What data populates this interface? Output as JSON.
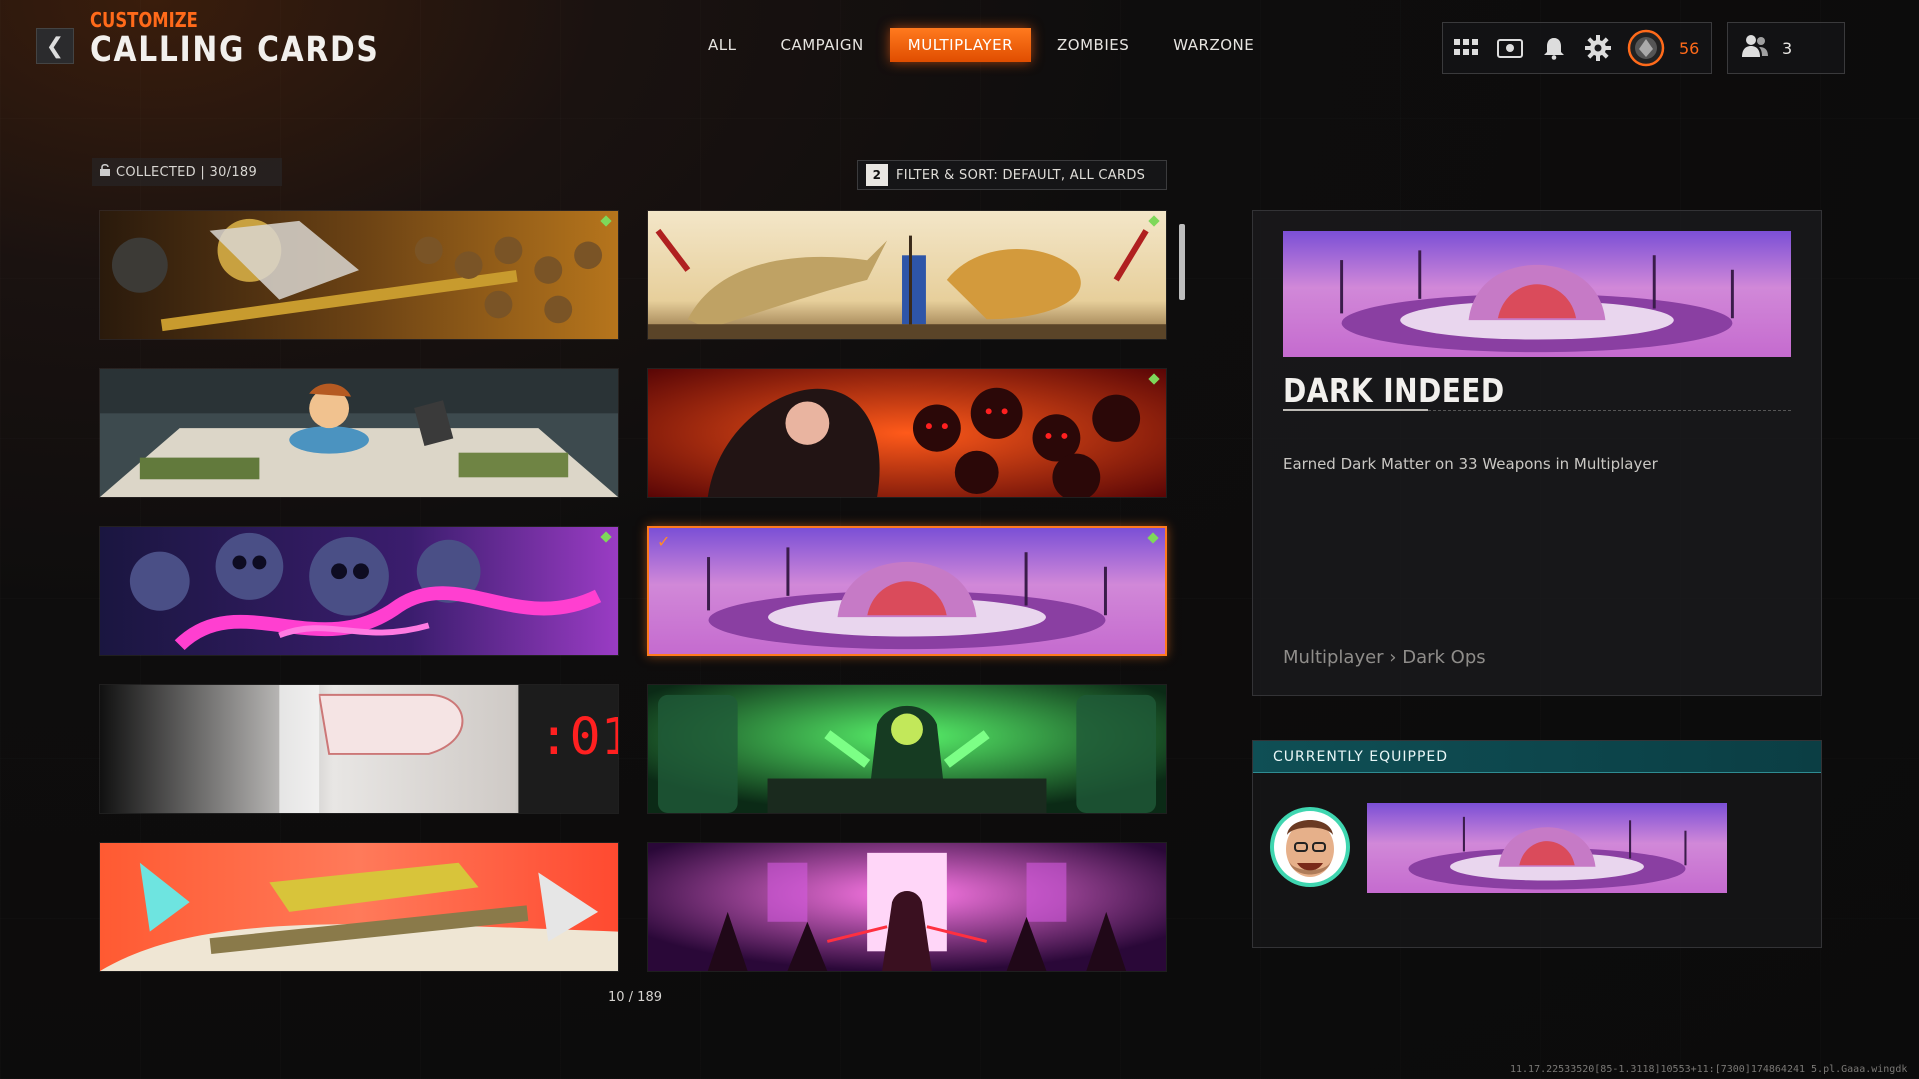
{
  "header": {
    "subtitle": "CUSTOMIZE",
    "title": "CALLING CARDS",
    "back_icon": "chevron-left-icon"
  },
  "tabs": [
    {
      "label": "ALL",
      "active": false
    },
    {
      "label": "CAMPAIGN",
      "active": false
    },
    {
      "label": "MULTIPLAYER",
      "active": true
    },
    {
      "label": "ZOMBIES",
      "active": false
    },
    {
      "label": "WARZONE",
      "active": false
    }
  ],
  "top_bar": {
    "icons": [
      "grid-menu-icon",
      "store-icon",
      "bell-icon",
      "gear-icon",
      "player-level-icon"
    ],
    "level": "56",
    "friends_icon": "friends-icon",
    "friends_count": "3"
  },
  "collection": {
    "collected_label": "COLLECTED | 30/189",
    "filter_key": "2",
    "filter_label": "FILTER & SORT: DEFAULT, ALL CARDS"
  },
  "cards": [
    {
      "id": "card-1",
      "theme": "golden-skull-sniper",
      "new": true,
      "selected": false,
      "equipped": false
    },
    {
      "id": "card-2",
      "theme": "crocodile-vs-lion",
      "new": true,
      "selected": false,
      "equipped": false
    },
    {
      "id": "card-3",
      "theme": "cereal-kid-desk",
      "new": false,
      "selected": false,
      "equipped": false
    },
    {
      "id": "card-4",
      "theme": "red-demon-skulls",
      "new": true,
      "selected": false,
      "equipped": false
    },
    {
      "id": "card-5",
      "theme": "purple-skulls-tentacles",
      "new": true,
      "selected": false,
      "equipped": false
    },
    {
      "id": "card-6",
      "theme": "dark-matter-brain",
      "new": true,
      "selected": true,
      "equipped": true
    },
    {
      "id": "card-7",
      "theme": "bomb-timer",
      "new": false,
      "selected": false,
      "equipped": false
    },
    {
      "id": "card-8",
      "theme": "green-necromancer-lab",
      "new": false,
      "selected": false,
      "equipped": false
    },
    {
      "id": "card-9",
      "theme": "mech-dragons-red",
      "new": false,
      "selected": false,
      "equipped": false
    },
    {
      "id": "card-10",
      "theme": "neon-ninja-pink",
      "new": false,
      "selected": false,
      "equipped": false
    }
  ],
  "page_count": "10 / 189",
  "detail": {
    "name": "DARK INDEED",
    "description": "Earned Dark Matter on 33 Weapons in Multiplayer",
    "path": "Multiplayer › Dark Ops"
  },
  "equipped": {
    "header": "CURRENTLY EQUIPPED",
    "avatar_icon": "player-avatar-icon"
  },
  "build_string": "11.17.22533520[85-1.3118]10553+11:[7300]174864241 5.pl.Gaaa.wingdk",
  "colors": {
    "accent": "#ff6a1a",
    "equipped_header": "#0f4f55",
    "new_badge": "#7ed85a"
  }
}
